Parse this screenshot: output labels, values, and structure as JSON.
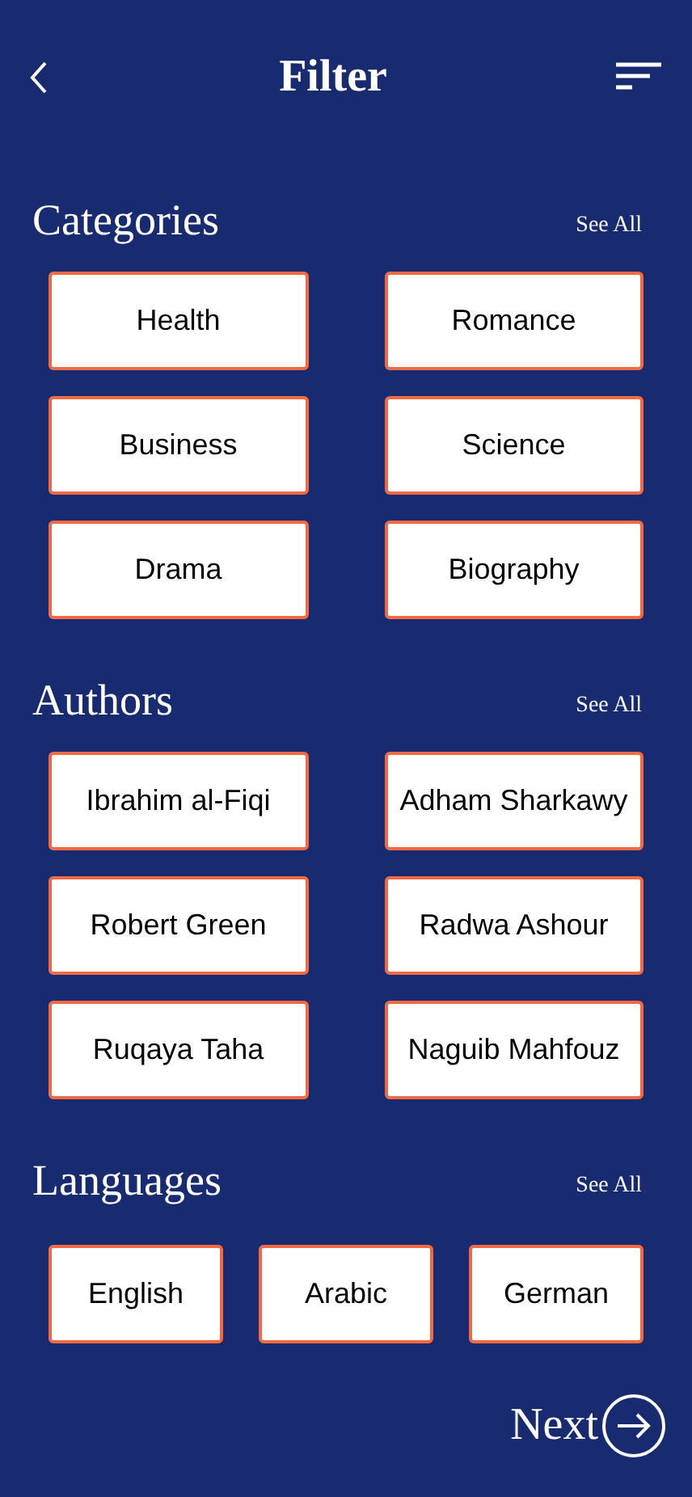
{
  "header": {
    "title": "Filter"
  },
  "sections": [
    {
      "title": "Categories",
      "see_all": "See All",
      "options": [
        "Health",
        "Romance",
        "Business",
        "Science",
        "Drama",
        "Biography"
      ]
    },
    {
      "title": "Authors",
      "see_all": "See All",
      "options": [
        "Ibrahim al-Fiqi",
        "Adham Sharkawy",
        "Robert Green",
        "Radwa Ashour",
        "Ruqaya Taha",
        "Naguib Mahfouz"
      ]
    },
    {
      "title": "Languages",
      "see_all": "See All",
      "options": [
        "English",
        "Arabic",
        "German"
      ]
    }
  ],
  "next_button": {
    "label": "Next"
  }
}
